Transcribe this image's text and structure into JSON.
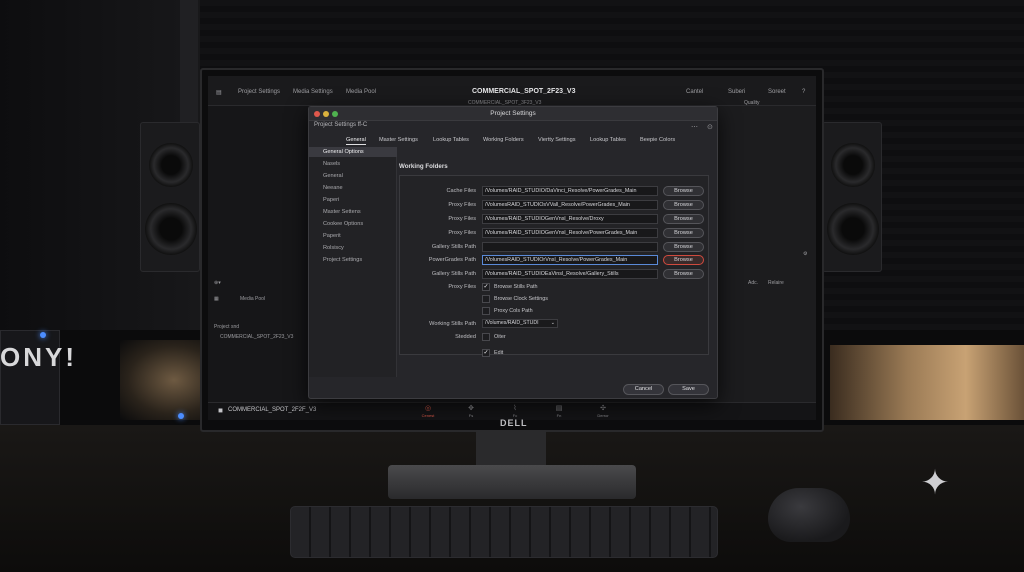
{
  "scene": {
    "brand_left": "ONY!",
    "monitor_brand": "DELL"
  },
  "app": {
    "menu_left_1": "Project Settings",
    "menu_left_2": "Media Settings",
    "menu_left_3": "Media Pool",
    "project_name": "COMMERCIAL_SPOT_2F23_V3",
    "right_1": "Cantel",
    "right_2": "Suberi",
    "right_3": "Soreet",
    "quality": "Quality",
    "sub_title": "COMMERCIAL_SPOT_3F23_V3",
    "media_pool": "Media Pool",
    "project_label": "Project snd",
    "project_item": "COMMERCIAL_SPOT_2F23_V3",
    "bottom_project": "COMMERCIAL_SPOT_2F2F_V3",
    "mid_right_1": "Adc.",
    "mid_right_2": "Relaire",
    "pages": [
      {
        "label": "Cenest",
        "icon": "◎"
      },
      {
        "label": "Fs",
        "icon": "✥"
      },
      {
        "label": "Fc",
        "icon": "⌇"
      },
      {
        "label": "Fn",
        "icon": "▤"
      },
      {
        "label": "Derror",
        "icon": "✣"
      }
    ]
  },
  "dialog": {
    "title": "Project Settings",
    "subtitle": "Project Settings ff-C",
    "tabs": [
      "General",
      "Master Settings",
      "Lookup Tables",
      "Working Folders",
      "Viertty Settings",
      "Lookup Tables",
      "Beepie Colors"
    ],
    "sidebar": [
      "General Options",
      "Nasels",
      "General",
      "Neeane",
      "Paperi",
      "Master Settens",
      "Cookee Options",
      "Paperit",
      "Rolsiscy",
      "Project Settings"
    ],
    "section_title": "Working Folders",
    "rows": [
      {
        "label": "Cache Files",
        "value": "/Volumes/RAID_STUDIO/DaVinci_Resolve/PowerGrades_Main",
        "button": "Browse"
      },
      {
        "label": "Proxy Files",
        "value": "/VolumesRAID_STUDIOsVVall_Resolve/PowerGrades_Main",
        "button": "Browse"
      },
      {
        "label": "Proxy Files",
        "value": "/Volumes/RAID_STUDIOGenVnsl_Resolve/Droxy",
        "button": "Browse"
      },
      {
        "label": "Proxy Files",
        "value": "/Volumes/RAID_STUDIOGenVnsl_Resolve/PowerGrades_Main",
        "button": "Browse"
      },
      {
        "label": "Gallery Stills Path",
        "value": "",
        "button": "Browse"
      },
      {
        "label": "PowerGrades Path",
        "value": "/VolumesRAID_STUDIOrVnsl_Resolve/PowerGrades_Main",
        "button": "Browse"
      },
      {
        "label": "Gallery Stills Path",
        "value": "/Volumes/RAID_STUDIOEaVinsl_Resolve/Gallery_Stills",
        "button": "Browse"
      }
    ],
    "checks": [
      {
        "row_label": "Proxy Files",
        "label": "Browse Stills Path",
        "checked": true
      },
      {
        "row_label": "",
        "label": "Browse Clock Settings",
        "checked": false
      },
      {
        "row_label": "",
        "label": "Proxy Cols Path",
        "checked": false
      }
    ],
    "select_label": "Working Stills Path",
    "select_value": "/Volumes/RAID_STUDI",
    "extra_label": "Stedded",
    "extra_check": "Oiter",
    "edit_check": "Edit",
    "cancel": "Cancel",
    "save": "Save"
  }
}
